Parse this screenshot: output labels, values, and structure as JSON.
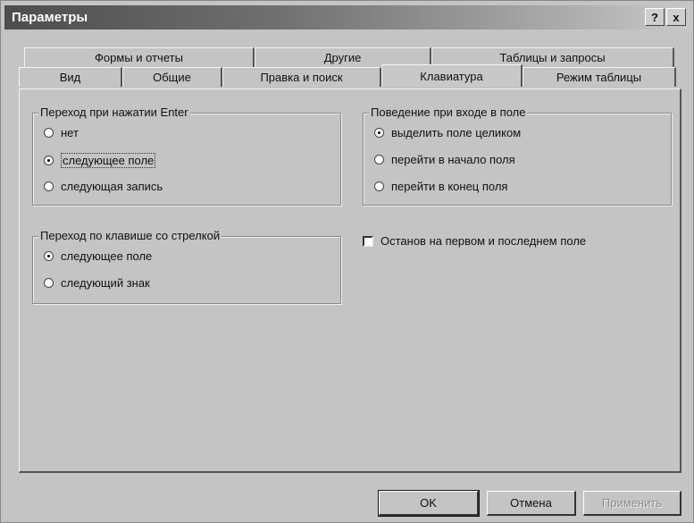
{
  "window": {
    "title": "Параметры",
    "help_label": "?",
    "close_label": "x"
  },
  "tabs": {
    "row1": [
      "Формы и отчеты",
      "Другие",
      "Таблицы и запросы"
    ],
    "row2": [
      "Вид",
      "Общие",
      "Правка и поиск",
      "Клавиатура",
      "Режим таблицы"
    ],
    "active": "Клавиатура"
  },
  "enter_group": {
    "legend": "Переход при нажатии Enter",
    "options": [
      {
        "label": "нет",
        "selected": false
      },
      {
        "label": "следующее поле",
        "selected": true
      },
      {
        "label": "следующая запись",
        "selected": false
      }
    ]
  },
  "field_group": {
    "legend": "Поведение при входе в поле",
    "options": [
      {
        "label": "выделить поле целиком",
        "selected": true
      },
      {
        "label": "перейти в начало поля",
        "selected": false
      },
      {
        "label": "перейти в конец поля",
        "selected": false
      }
    ]
  },
  "arrow_group": {
    "legend": "Переход по клавише со стрелкой",
    "options": [
      {
        "label": "следующее поле",
        "selected": true
      },
      {
        "label": "следующий знак",
        "selected": false
      }
    ]
  },
  "stop_checkbox": {
    "label": "Останов на первом и последнем поле",
    "checked": false
  },
  "buttons": {
    "ok": "OK",
    "cancel": "Отмена",
    "apply": "Применить"
  }
}
